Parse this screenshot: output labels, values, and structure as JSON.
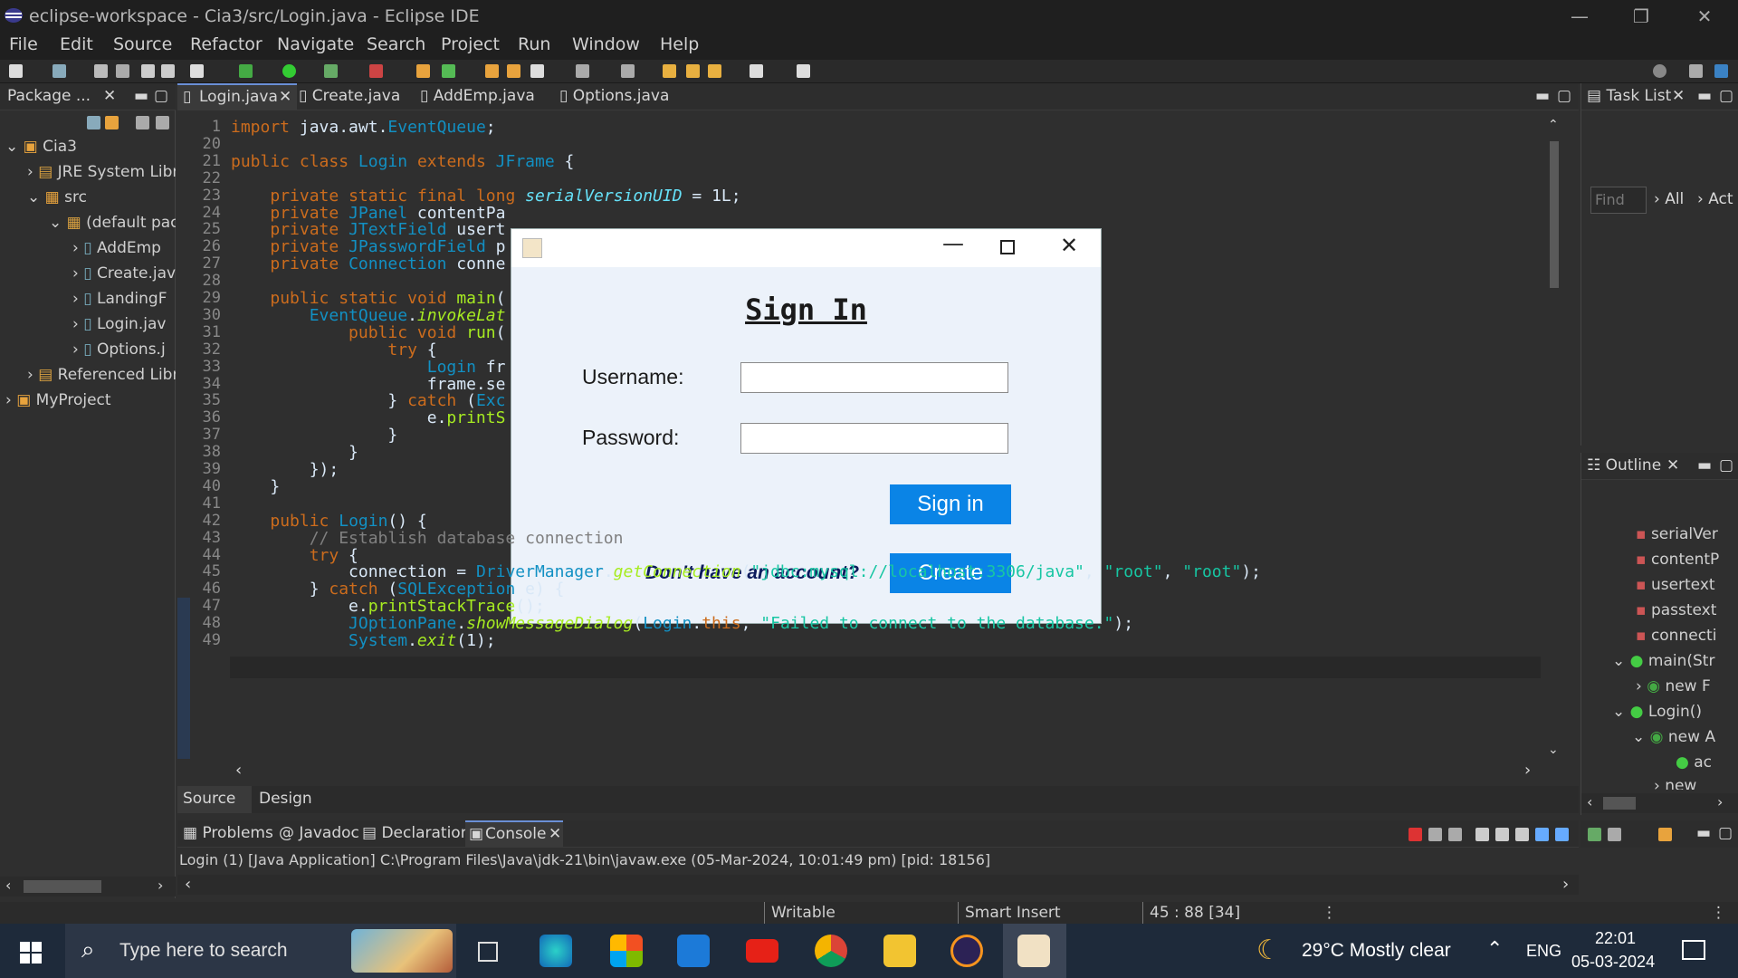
{
  "window": {
    "title": "eclipse-workspace - Cia3/src/Login.java - Eclipse IDE",
    "minimize": "—",
    "restore": "❐",
    "close": "✕"
  },
  "menu": [
    "File",
    "Edit",
    "Source",
    "Refactor",
    "Navigate",
    "Search",
    "Project",
    "Run",
    "Window",
    "Help"
  ],
  "package_explorer": {
    "tab": "Package ...",
    "items": [
      "Cia3",
      "JRE System Libr",
      "src",
      "(default pac",
      "AddEmp",
      "Create.jav",
      "LandingF",
      "Login.jav",
      "Options.j",
      "Referenced Libr",
      "MyProject"
    ]
  },
  "editor_tabs": [
    "Login.java",
    "Create.java",
    "AddEmp.java",
    "Options.java"
  ],
  "code": [
    {
      "n": "1",
      "t": "import java.awt.EventQueue;"
    },
    {
      "n": "20",
      "t": ""
    },
    {
      "n": "21",
      "t": "public class Login extends JFrame {"
    },
    {
      "n": "22",
      "t": ""
    },
    {
      "n": "23",
      "t": "    private static final long serialVersionUID = 1L;"
    },
    {
      "n": "24",
      "t": "    private JPanel contentPa"
    },
    {
      "n": "25",
      "t": "    private JTextField usert"
    },
    {
      "n": "26",
      "t": "    private JPasswordField p"
    },
    {
      "n": "27",
      "t": "    private Connection conne"
    },
    {
      "n": "28",
      "t": ""
    },
    {
      "n": "29",
      "t": "    public static void main("
    },
    {
      "n": "30",
      "t": "        EventQueue.invokeLat"
    },
    {
      "n": "31",
      "t": "            public void run("
    },
    {
      "n": "32",
      "t": "                try {"
    },
    {
      "n": "33",
      "t": "                    Login fr"
    },
    {
      "n": "34",
      "t": "                    frame.se"
    },
    {
      "n": "35",
      "t": "                } catch (Exc"
    },
    {
      "n": "36",
      "t": "                    e.printS"
    },
    {
      "n": "37",
      "t": "                }"
    },
    {
      "n": "38",
      "t": "            }"
    },
    {
      "n": "39",
      "t": "        });"
    },
    {
      "n": "40",
      "t": "    }"
    },
    {
      "n": "41",
      "t": ""
    },
    {
      "n": "42",
      "t": "    public Login() {"
    },
    {
      "n": "43",
      "t": "        // Establish database connection"
    },
    {
      "n": "44",
      "t": "        try {"
    },
    {
      "n": "45",
      "t": "            connection = DriverManager.getConnection(\"jdbc:mysql://localhost:3306/java\", \"root\", \"root\");"
    },
    {
      "n": "46",
      "t": "        } catch (SQLException e) {"
    },
    {
      "n": "47",
      "t": "            e.printStackTrace();"
    },
    {
      "n": "48",
      "t": "            JOptionPane.showMessageDialog(Login.this, \"Failed to connect to the database.\");"
    },
    {
      "n": "49",
      "t": "            System.exit(1);"
    }
  ],
  "editor_bottom_tabs": [
    "Source",
    "Design"
  ],
  "task_list": {
    "tab": "Task List",
    "find_placeholder": "Find",
    "all": "All",
    "act": "Act"
  },
  "outline": {
    "tab": "Outline",
    "items": [
      "serialVer",
      "contentP",
      "usertext",
      "passtext",
      "connecti",
      "main(Str",
      "new F",
      "Login()",
      "new A",
      "ac",
      "new"
    ]
  },
  "console_tabs": [
    "Problems",
    "Javadoc",
    "Declaration",
    "Console"
  ],
  "console_line": "Login (1) [Java Application] C:\\Program Files\\Java\\jdk-21\\bin\\javaw.exe  (05-Mar-2024, 10:01:49 pm) [pid: 18156]",
  "status": {
    "writable": "Writable",
    "insert": "Smart Insert",
    "position": "45 : 88 [34]"
  },
  "dialog": {
    "heading": "Sign In",
    "username_label": "Username:",
    "password_label": "Password:",
    "signin_button": "Sign in",
    "no_account": "Don't have an account?",
    "create_button": "Create",
    "username_value": "",
    "password_value": ""
  },
  "taskbar": {
    "search_placeholder": "Type here to search",
    "weather": "29°C  Mostly clear",
    "lang": "ENG",
    "time": "22:01",
    "date": "05-03-2024"
  },
  "colors": {
    "keyword": "#cc6c1d",
    "type": "#1290c3",
    "method": "#a7ec21",
    "string": "#17c6a3",
    "button": "#0a84e6"
  }
}
